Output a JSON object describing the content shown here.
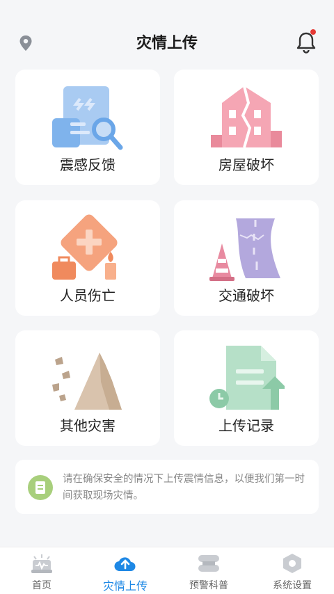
{
  "header": {
    "title": "灾情上传"
  },
  "cards": [
    {
      "label": "震感反馈"
    },
    {
      "label": "房屋破坏"
    },
    {
      "label": "人员伤亡"
    },
    {
      "label": "交通破坏"
    },
    {
      "label": "其他灾害"
    },
    {
      "label": "上传记录"
    }
  ],
  "notice": {
    "text": "请在确保安全的情况下上传震情信息，以便我们第一时间获取现场灾情。"
  },
  "tabs": [
    {
      "label": "首页",
      "icon": "alarm-icon"
    },
    {
      "label": "灾情上传",
      "icon": "cloud-upload-icon"
    },
    {
      "label": "预警科普",
      "icon": "book-icon"
    },
    {
      "label": "系统设置",
      "icon": "gear-icon"
    }
  ],
  "colors": {
    "accent": "#1e88e5",
    "badge": "#e53935"
  }
}
